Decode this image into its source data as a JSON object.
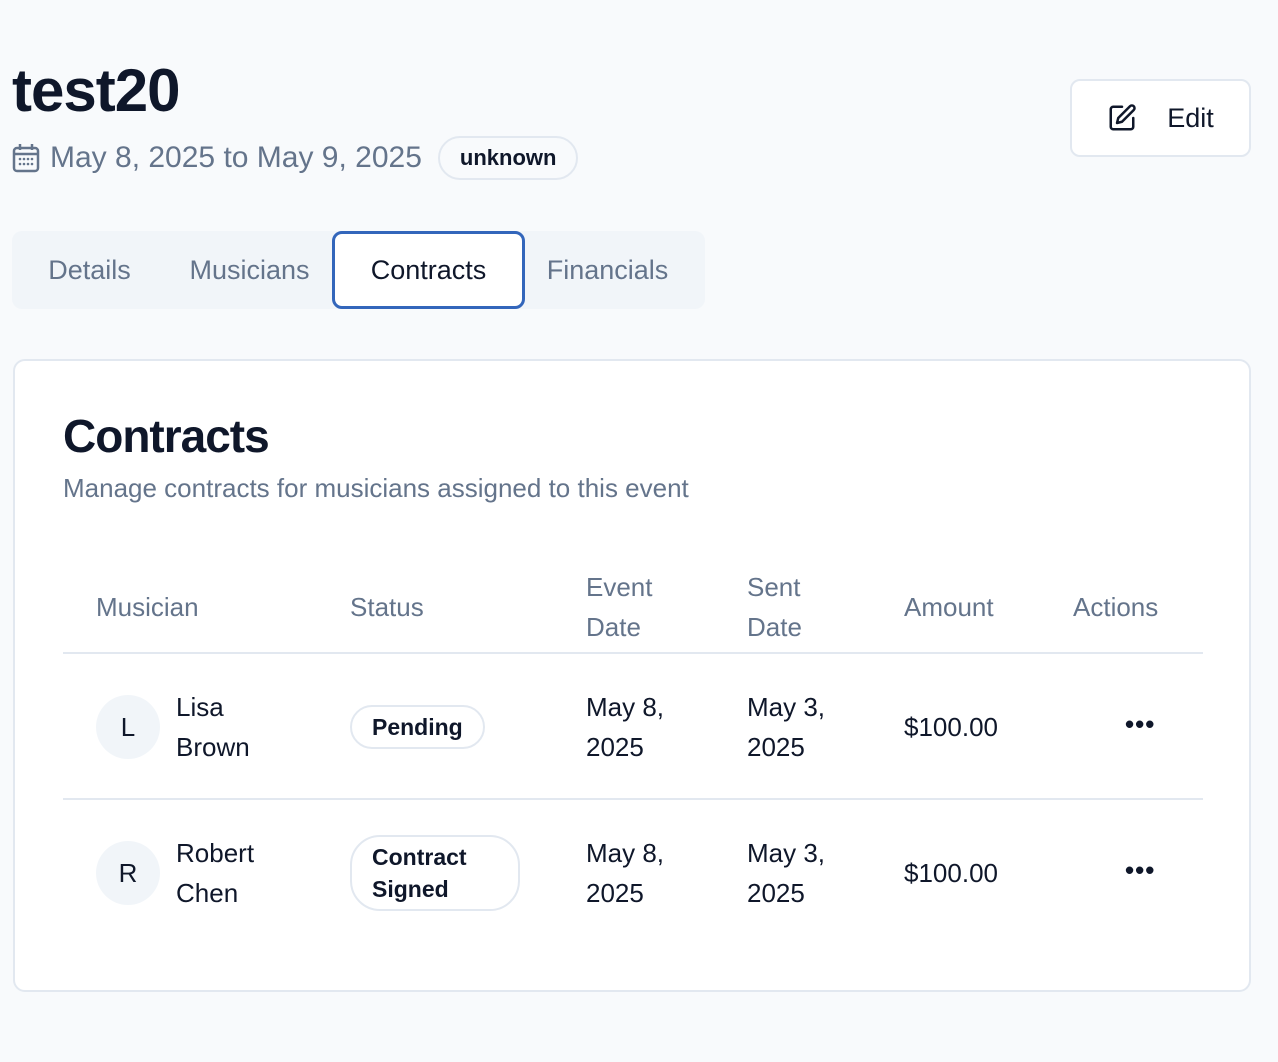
{
  "event": {
    "title": "test20",
    "date_range": "May 8, 2025 to May 9, 2025",
    "status_badge": "unknown",
    "edit_label": "Edit"
  },
  "tabs": [
    {
      "label": "Details"
    },
    {
      "label": "Musicians"
    },
    {
      "label": "Contracts",
      "active": true
    },
    {
      "label": "Financials"
    }
  ],
  "contracts": {
    "title": "Contracts",
    "subtitle": "Manage contracts for musicians assigned to this event",
    "columns": [
      "Musician",
      "Status",
      "Event Date",
      "Sent Date",
      "Amount",
      "Actions"
    ],
    "rows": [
      {
        "initial": "L",
        "musician": "Lisa Brown",
        "status": "Pending",
        "event_date": "May 8, 2025",
        "sent_date": "May 3, 2025",
        "amount": "$100.00",
        "actions": "•••"
      },
      {
        "initial": "R",
        "musician": "Robert Chen",
        "status": "Contract Signed",
        "event_date": "May 8, 2025",
        "sent_date": "May 3, 2025",
        "amount": "$100.00",
        "actions": "•••"
      }
    ]
  },
  "colors": {
    "accent": "#3366bb",
    "muted_text": "#64748b",
    "background": "#f8fafc"
  }
}
